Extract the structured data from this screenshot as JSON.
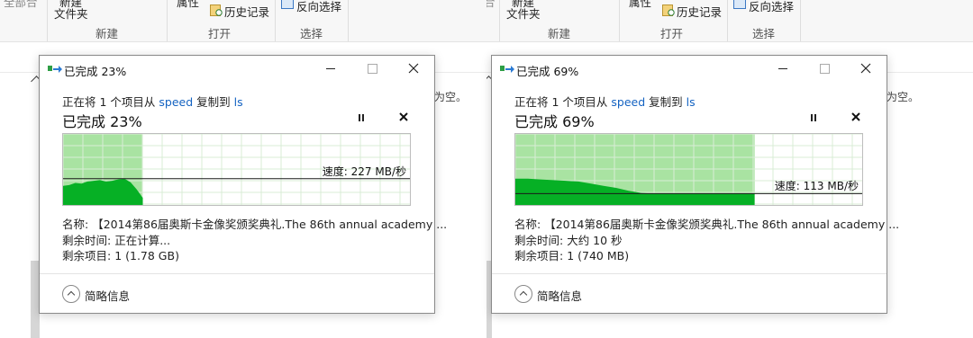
{
  "explorer_ribbon": {
    "partial_left": "全部合",
    "new_folder_line1": "新建",
    "new_folder_line2": "文件夹",
    "group_new": "新建",
    "open_partial": "属性",
    "history": "历史记录",
    "group_open": "打开",
    "invert_selection": "反向选择",
    "group_select": "选择"
  },
  "explorer_content": {
    "empty_suffix": "为空。"
  },
  "dialogs": [
    {
      "window_title": "已完成 23%",
      "from_prefix": "正在将 1 个项目从",
      "source": "speed",
      "copy_to": "复制到",
      "destination": "ls",
      "status": "已完成 23%",
      "speed": "速度: 227 MB/秒",
      "name_label": "名称:",
      "name_value": "【2014第86届奥斯卡金像奖颁奖典礼.The 86th annual academy ...",
      "time_label": "剩余时间:",
      "time_value": "正在计算...",
      "items_label": "剩余项目:",
      "items_value": "1 (1.78 GB)",
      "details_toggle": "简略信息",
      "progress": 0.23,
      "speed_level": 0.37
    },
    {
      "window_title": "已完成 69%",
      "from_prefix": "正在将 1 个项目从",
      "source": "speed",
      "copy_to": "复制到",
      "destination": "ls",
      "status": "已完成 69%",
      "speed": "速度: 113 MB/秒",
      "name_label": "名称:",
      "name_value": "【2014第86届奥斯卡金像奖颁奖典礼.The 86th annual academy ...",
      "time_label": "剩余时间:",
      "time_value": "大约 10 秒",
      "items_label": "剩余项目:",
      "items_value": "1 (740 MB)",
      "details_toggle": "简略信息",
      "progress": 0.69,
      "speed_level": 0.16
    }
  ],
  "colors": {
    "graph_light": "#a9e3a2",
    "graph_dark": "#06b025",
    "grid": "#d9ecd6",
    "link": "#1463c2"
  }
}
